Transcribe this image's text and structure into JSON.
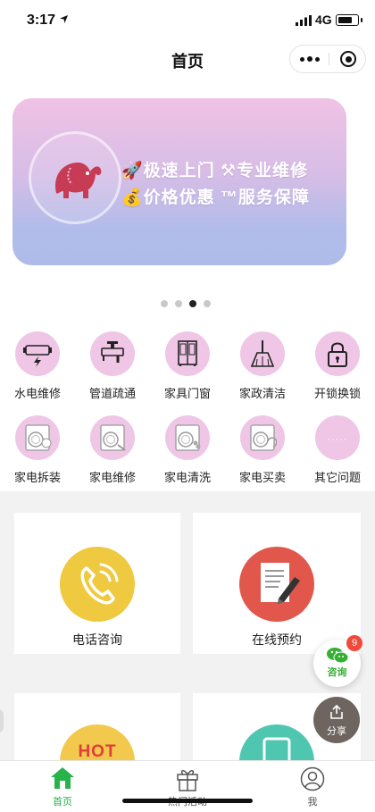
{
  "status_bar": {
    "time": "3:17",
    "network": "4G",
    "battery_level": 0.75
  },
  "nav": {
    "title": "首页"
  },
  "banner": {
    "line1": "🚀极速上门 ⚒专业维修",
    "line2": "💰价格优惠 ™服务保障",
    "slide_count": 4,
    "active_slide": 3
  },
  "categories": [
    {
      "label": "水电维修",
      "icon": "battery-lightning-icon"
    },
    {
      "label": "管道疏通",
      "icon": "faucet-icon"
    },
    {
      "label": "家具门窗",
      "icon": "wardrobe-icon"
    },
    {
      "label": "家政清洁",
      "icon": "broom-icon"
    },
    {
      "label": "开锁换锁",
      "icon": "padlock-icon"
    },
    {
      "label": "家电拆装",
      "icon": "washing-machine-icon"
    },
    {
      "label": "家电维修",
      "icon": "washing-machine-icon"
    },
    {
      "label": "家电清洗",
      "icon": "washing-machine-icon"
    },
    {
      "label": "家电买卖",
      "icon": "washing-machine-icon"
    },
    {
      "label": "其它问题",
      "icon": "more-icon",
      "more_text": "·····"
    }
  ],
  "cards": [
    {
      "label": "电话咨询",
      "icon": "phone-icon",
      "color": "#efc93f"
    },
    {
      "label": "在线预约",
      "icon": "document-pen-icon",
      "color": "#e2574c"
    },
    {
      "label": "",
      "icon": "hot-icon",
      "color": "#f2c94c",
      "icon_text": "HOT"
    },
    {
      "label": "",
      "icon": "tablet-icon",
      "color": "#4fc7b0"
    }
  ],
  "float": {
    "consult_label": "咨询",
    "consult_badge": "9",
    "share_label": "分享"
  },
  "tabs": [
    {
      "label": "首页",
      "icon": "home-icon",
      "active": true
    },
    {
      "label": "热门活动",
      "icon": "gift-icon",
      "active": false
    },
    {
      "label": "我",
      "icon": "user-icon",
      "active": false
    }
  ],
  "colors": {
    "accent": "#25b34a",
    "category_circle": "#efc6e6"
  }
}
